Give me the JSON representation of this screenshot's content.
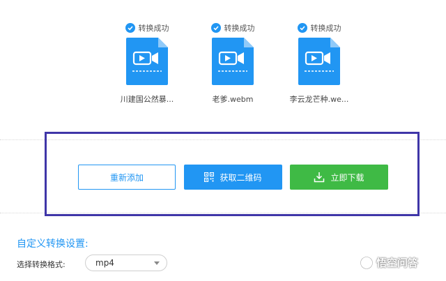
{
  "files": [
    {
      "status": "转换成功",
      "name": "川建国公然暴..."
    },
    {
      "status": "转换成功",
      "name": "老爹.webm"
    },
    {
      "status": "转换成功",
      "name": "李云龙芒种.we..."
    }
  ],
  "actions": {
    "readd_label": "重新添加",
    "qrcode_label": "获取二维码",
    "download_label": "立即下载"
  },
  "settings": {
    "title": "自定义转换设置:",
    "format_label": "选择转换格式:",
    "format_value": "mp4"
  },
  "watermark": {
    "text": "悟空问答"
  },
  "colors": {
    "accent": "#2196f3",
    "success": "#3fba45",
    "highlight": "#3f36a8"
  },
  "icons": {
    "status": "check-circle-icon",
    "file": "video-file-icon",
    "qr": "qr-code-icon",
    "download": "download-icon"
  }
}
